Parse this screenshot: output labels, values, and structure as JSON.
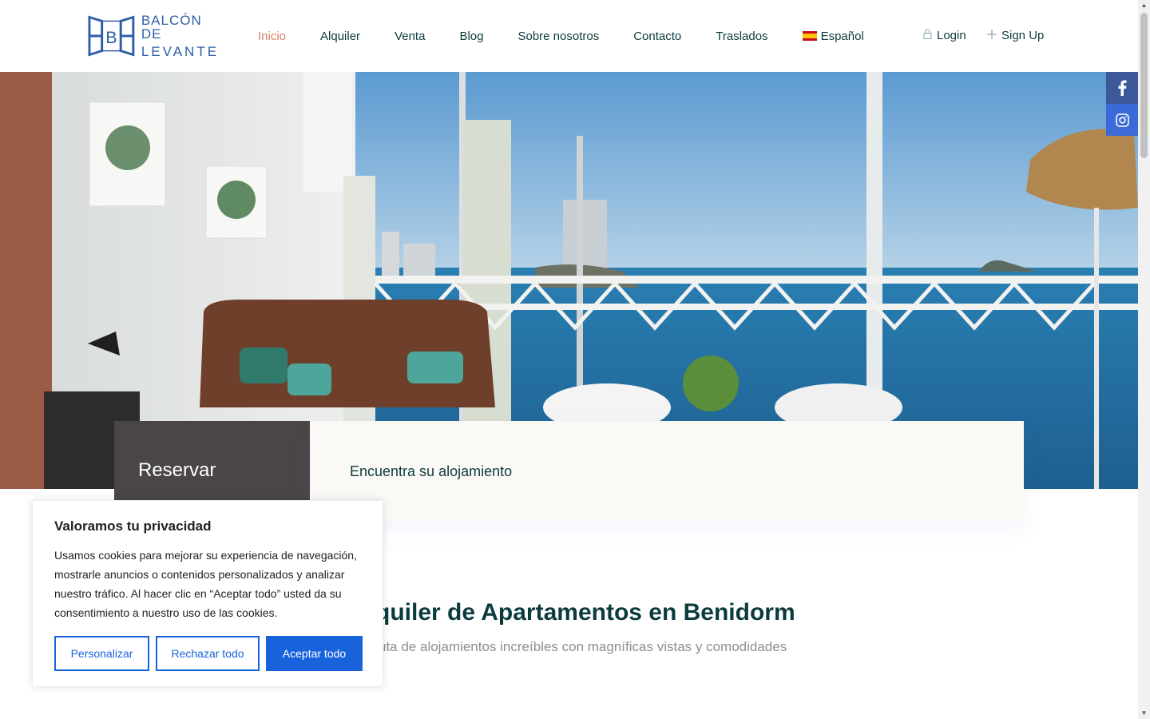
{
  "logo": {
    "letter": "B",
    "line1": "BALCÓN DE",
    "line2": "LEVANTE"
  },
  "nav": {
    "items": [
      {
        "label": "Inicio"
      },
      {
        "label": "Alquiler"
      },
      {
        "label": "Venta"
      },
      {
        "label": "Blog"
      },
      {
        "label": "Sobre nosotros"
      },
      {
        "label": "Contacto"
      },
      {
        "label": "Traslados"
      }
    ],
    "language": "Español"
  },
  "auth": {
    "login": "Login",
    "signup": "Sign Up"
  },
  "social": {
    "facebook": "f"
  },
  "booking": {
    "left_label": "Reservar",
    "right_label": "Encuentra su alojamiento"
  },
  "section": {
    "title": "quiler de Apartamentos en Benidorm",
    "subtitle": "uta de alojamientos increíbles con magníficas vistas y comodidades"
  },
  "cookie": {
    "title": "Valoramos tu privacidad",
    "text": "Usamos cookies para mejorar su experiencia de navegación, mostrarle anuncios o contenidos personalizados y analizar nuestro tráfico. Al hacer clic en “Aceptar todo” usted da su consentimiento a nuestro uso de las cookies.",
    "customize": "Personalizar",
    "reject": "Rechazar todo",
    "accept": "Aceptar todo"
  },
  "colors": {
    "nav_active": "#d9806a",
    "nav_text": "#0b3b3c",
    "cookie_primary": "#1863dc",
    "facebook": "#3b5998",
    "instagram": "#3b6ad8"
  }
}
